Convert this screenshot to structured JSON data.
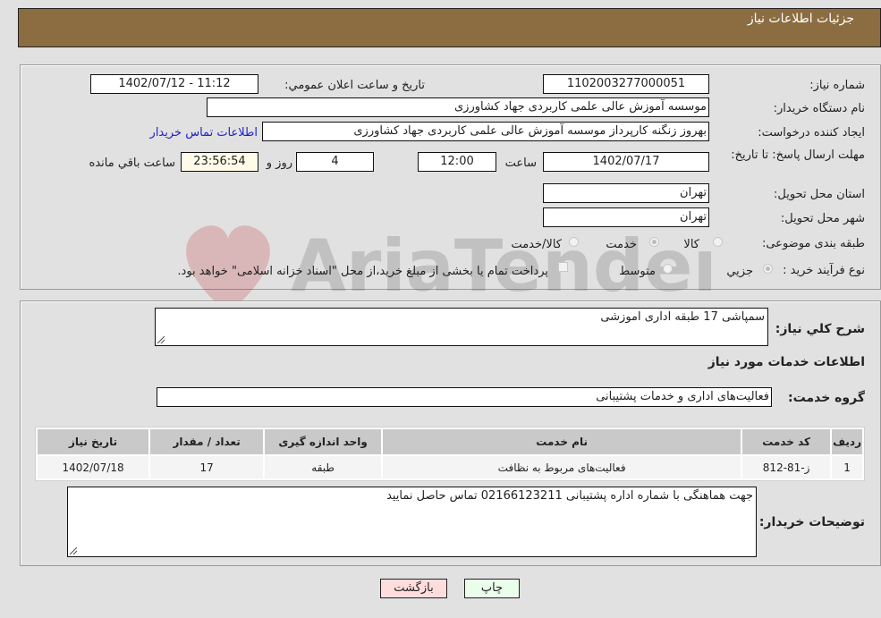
{
  "header": {
    "title": "جزئیات اطلاعات نیاز"
  },
  "form": {
    "need_number": {
      "label": "شماره نیاز:",
      "value": "1102003277000051"
    },
    "announce_datetime": {
      "label": "تاریخ و ساعت اعلان عمومي:",
      "value": "1402/07/12 - 11:12"
    },
    "buyer_org": {
      "label": "نام دستگاه خريدار:",
      "value": "موسسه آموزش عالی علمی کاربردی جهاد کشاورزی"
    },
    "requester": {
      "label": "ایجاد کننده درخواست:",
      "value": "بهروز زنگنه کارپرداز موسسه آموزش عالی علمی کاربردی جهاد کشاورزی"
    },
    "buyer_contact_link": "اطلاعات تماس خریدار",
    "deadline": {
      "label": "مهلت ارسال پاسخ: تا تاریخ:",
      "date": "1402/07/17",
      "time_label": "ساعت",
      "time": "12:00",
      "days": "4",
      "days_label": "روز و",
      "remaining": "23:56:54",
      "remaining_label": "ساعت باقي مانده"
    },
    "delivery_province": {
      "label": "استان محل تحویل:",
      "value": "تهران"
    },
    "delivery_city": {
      "label": "شهر محل تحویل:",
      "value": "تهران"
    },
    "category": {
      "label": "طبقه بندی موضوعی:",
      "options": [
        "کالا",
        "خدمت",
        "کالا/خدمت"
      ],
      "selected": "خدمت"
    },
    "purchase_process": {
      "label": "نوع فرآیند خرید :",
      "options": [
        "جزيي",
        "متوسط"
      ],
      "selected": "جزيي",
      "treasury_note": "پرداخت تمام یا بخشی از مبلغ خرید،از محل \"اسناد خزانه اسلامی\" خواهد بود."
    }
  },
  "details": {
    "summary_label": "شرح کلي نياز:",
    "summary_value": "سمپاشی 17 طبقه اداری اموزشی",
    "services_heading": "اطلاعات خدمات مورد نیاز",
    "service_group_label": "گروه خدمت:",
    "service_group_value": "فعالیت‌های اداری و خدمات پشتیبانی",
    "table": {
      "headers": [
        "ردیف",
        "کد خدمت",
        "نام خدمت",
        "واحد اندازه گیری",
        "تعداد / مقدار",
        "تاریخ نیاز"
      ],
      "rows": [
        [
          "1",
          "ز-81-812",
          "فعالیت‌های مربوط به نظافت",
          "طبقه",
          "17",
          "1402/07/18"
        ]
      ]
    },
    "buyer_notes_label": "توضیحات خریدار:",
    "buyer_notes_value": "جهت هماهنگی با شماره اداره پشتیبانی 02166123211 تماس حاصل نمایید"
  },
  "buttons": {
    "print": "چاپ",
    "back": "بازگشت"
  },
  "watermark": "AriaTender.net",
  "colors": {
    "header": "#8c6d42",
    "print_bg": "#eaffea",
    "back_bg": "#ffdddd",
    "link": "#2020cc"
  }
}
